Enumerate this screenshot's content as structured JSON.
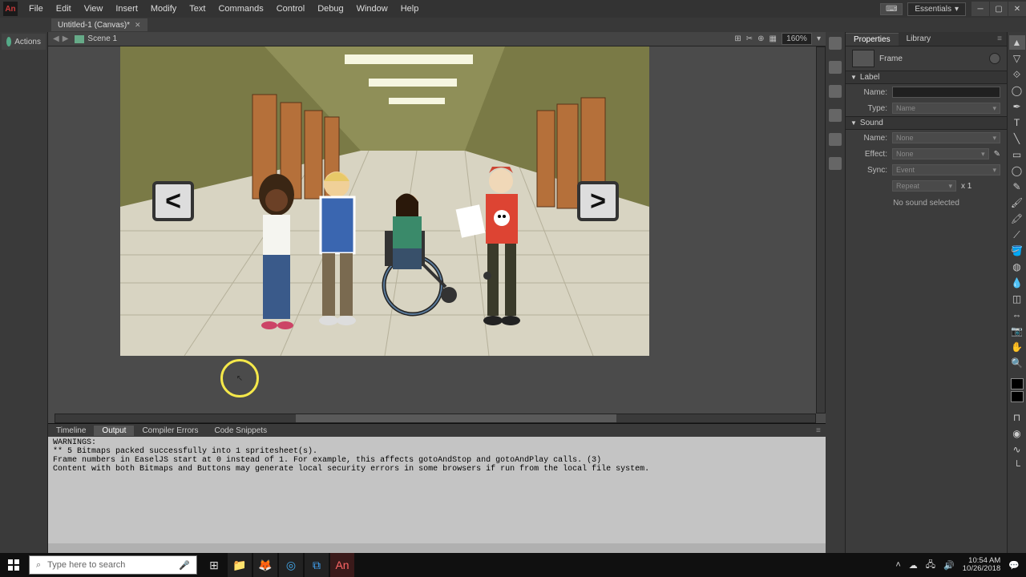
{
  "app": {
    "logo": "An"
  },
  "menu": [
    "File",
    "Edit",
    "View",
    "Insert",
    "Modify",
    "Text",
    "Commands",
    "Control",
    "Debug",
    "Window",
    "Help"
  ],
  "workspace": {
    "label": "Essentials"
  },
  "document": {
    "tab": "Untitled-1 (Canvas)*"
  },
  "actions": {
    "label": "Actions"
  },
  "scene": {
    "name": "Scene 1",
    "zoom": "160%"
  },
  "stage": {
    "prev": "<",
    "next": ">"
  },
  "bottom_tabs": [
    "Timeline",
    "Output",
    "Compiler Errors",
    "Code Snippets"
  ],
  "active_bottom_tab": 1,
  "output_text": "WARNINGS:\n** 5 Bitmaps packed successfully into 1 spritesheet(s).\nFrame numbers in EaselJS start at 0 instead of 1. For example, this affects gotoAndStop and gotoAndPlay calls. (3)\nContent with both Bitmaps and Buttons may generate local security errors in some browsers if run from the local file system.",
  "properties": {
    "tabs": [
      "Properties",
      "Library"
    ],
    "active_tab": 0,
    "object_type": "Frame",
    "sections": {
      "label": {
        "title": "Label",
        "name_label": "Name:",
        "name_value": "",
        "type_label": "Type:",
        "type_value": "Name"
      },
      "sound": {
        "title": "Sound",
        "name_label": "Name:",
        "name_value": "None",
        "effect_label": "Effect:",
        "effect_value": "None",
        "sync_label": "Sync:",
        "sync_value": "Event",
        "repeat_value": "Repeat",
        "repeat_x": "x 1",
        "no_sound": "No sound selected"
      }
    }
  },
  "taskbar": {
    "search_placeholder": "Type here to search",
    "time": "10:54 AM",
    "date": "10/26/2018"
  }
}
